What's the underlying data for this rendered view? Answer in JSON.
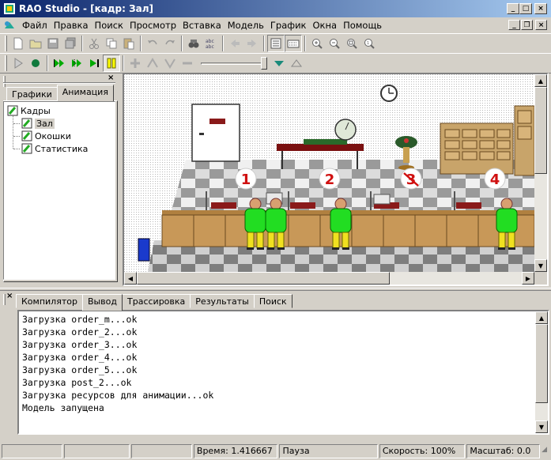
{
  "window": {
    "title": "RAO Studio - [кадр: Зал]"
  },
  "menu": [
    {
      "label": "Файл"
    },
    {
      "label": "Правка"
    },
    {
      "label": "Поиск"
    },
    {
      "label": "Просмотр"
    },
    {
      "label": "Вставка"
    },
    {
      "label": "Модель"
    },
    {
      "label": "График"
    },
    {
      "label": "Окна"
    },
    {
      "label": "Помощь"
    }
  ],
  "left_panel": {
    "tabs": [
      {
        "label": "Графики"
      },
      {
        "label": "Анимация"
      }
    ],
    "active_tab": "Анимация",
    "tree": {
      "root": "Кадры",
      "children": [
        {
          "label": "Зал",
          "selected": true
        },
        {
          "label": "Окошки"
        },
        {
          "label": "Статистика"
        }
      ]
    }
  },
  "scene": {
    "windows": [
      "1",
      "2",
      "3",
      "4"
    ],
    "closed_window": "3"
  },
  "bottom_panel": {
    "tabs": [
      {
        "label": "Компилятор"
      },
      {
        "label": "Вывод"
      },
      {
        "label": "Трассировка"
      },
      {
        "label": "Результаты"
      },
      {
        "label": "Поиск"
      }
    ],
    "active_tab": "Вывод",
    "lines": [
      "Загрузка order_m...ok",
      "Загрузка order_2...ok",
      "Загрузка order_3...ok",
      "Загрузка order_4...ok",
      "Загрузка order_5...ok",
      "Загрузка post_2...ok",
      "Загрузка ресурсов для анимации...ok",
      "Модель запущена"
    ]
  },
  "status": {
    "time": "Время: 1.416667",
    "state": "Пауза",
    "speed": "Скорость: 100%",
    "scale": "Масштаб: 0.0"
  },
  "colors": {
    "title_start": "#0a246a",
    "title_end": "#a6caf0",
    "face": "#d4d0c8",
    "accent_play": "#008000"
  }
}
